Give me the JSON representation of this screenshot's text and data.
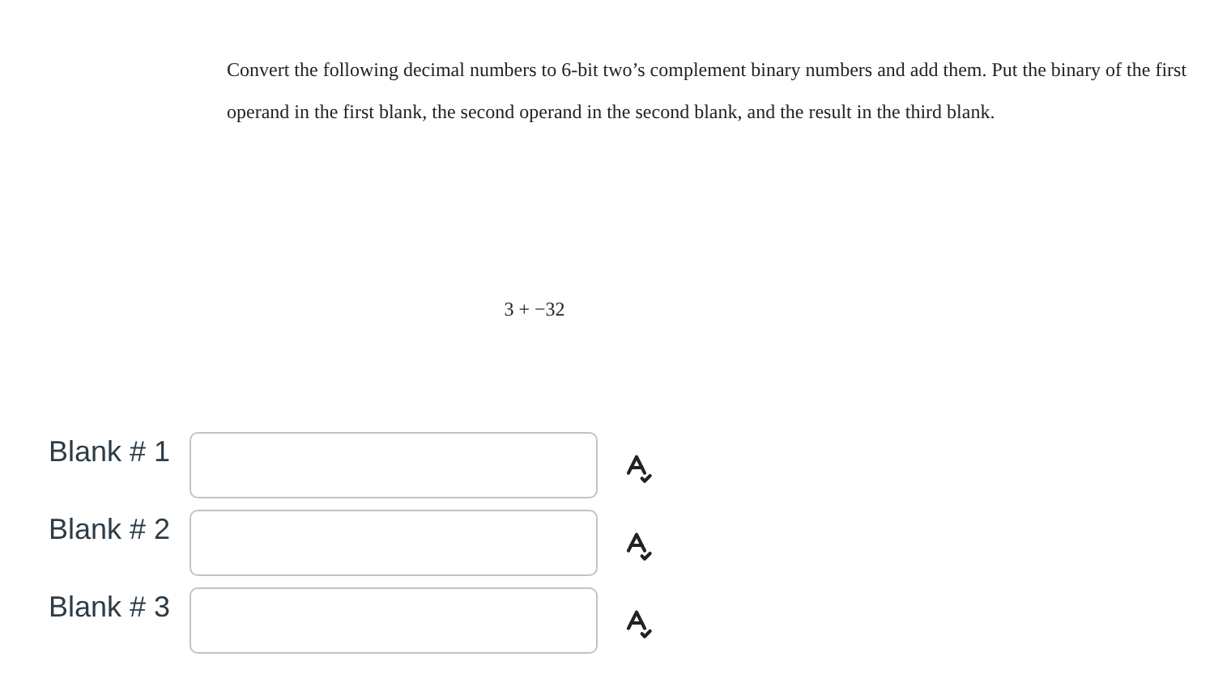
{
  "instructions": "Convert the following decimal numbers to 6-bit two’s complement binary numbers and add them. Put the binary of the first operand in the first blank, the second operand in the second blank, and the result in the third blank.",
  "expression": "3 + −32",
  "blanks": [
    {
      "label": "Blank # 1"
    },
    {
      "label": "Blank # 2"
    },
    {
      "label": "Blank # 3"
    }
  ]
}
